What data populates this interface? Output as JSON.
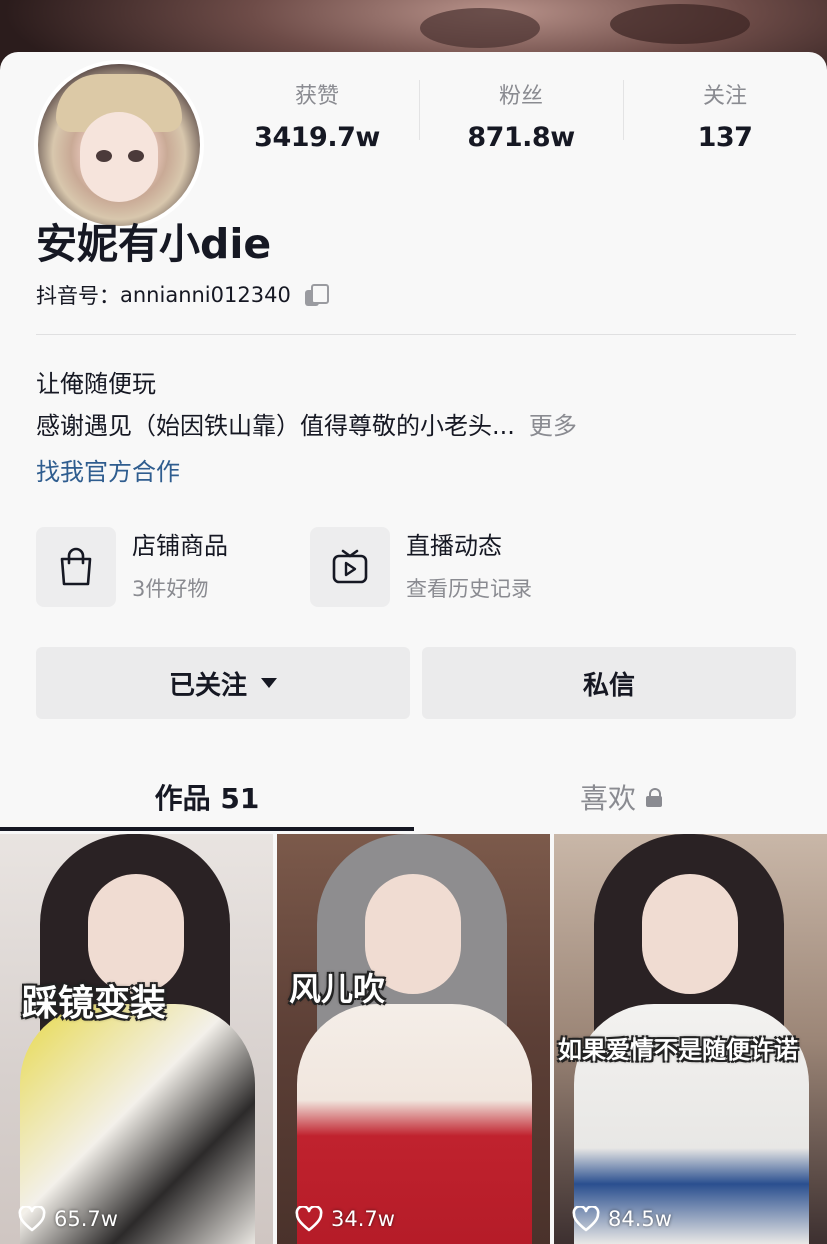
{
  "profile": {
    "name": "安妮有小die",
    "account_prefix": "抖音号：",
    "account_id": "annianni012340",
    "stats": [
      {
        "label": "获赞",
        "value": "3419.7w"
      },
      {
        "label": "粉丝",
        "value": "871.8w"
      },
      {
        "label": "关注",
        "value": "137"
      }
    ],
    "bio_line1": "让俺随便玩",
    "bio_line2": "感谢遇见（始因铁山靠）值得尊敬的小老头...",
    "bio_more": "更多",
    "bio_link": "找我官方合作"
  },
  "entries": [
    {
      "title": "店铺商品",
      "subtitle": "3件好物",
      "icon": "shopping-bag-icon"
    },
    {
      "title": "直播动态",
      "subtitle": "查看历史记录",
      "icon": "tv-play-icon"
    }
  ],
  "actions": {
    "follow_label": "已关注",
    "message_label": "私信"
  },
  "tabs": {
    "works_label": "作品 51",
    "likes_label": "喜欢"
  },
  "videos": [
    {
      "caption": "踩镜变装",
      "likes": "65.7w"
    },
    {
      "caption": "风儿吹",
      "likes": "34.7w"
    },
    {
      "caption": "如果爱情不是随便许诺",
      "likes": "84.5w"
    }
  ],
  "colors": {
    "text": "#161823",
    "muted": "#8a8b91",
    "link": "#2f5d8f",
    "button_bg": "#ebebec"
  }
}
